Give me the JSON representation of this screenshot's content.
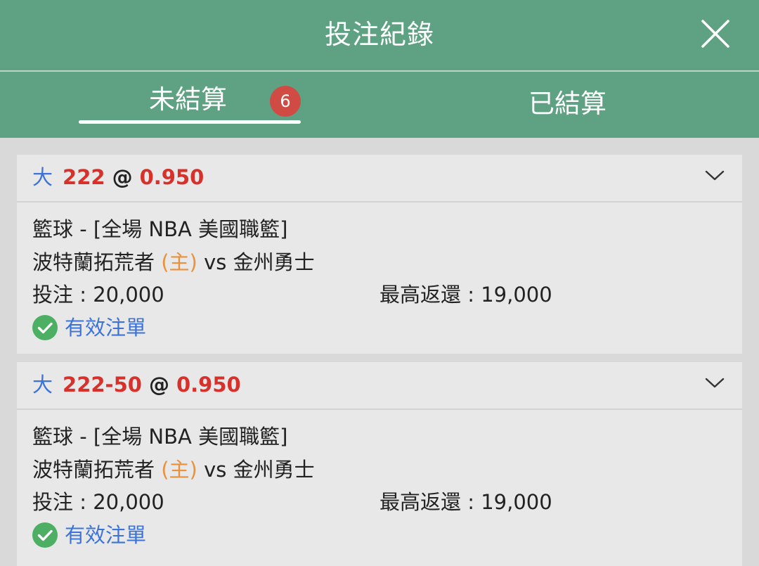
{
  "header": {
    "title": "投注紀錄"
  },
  "tabs": [
    {
      "label": "未結算",
      "badge": "6",
      "active": true
    },
    {
      "label": "已結算",
      "active": false
    }
  ],
  "colors": {
    "header_bg": "#5fa283",
    "badge_bg": "#d14b45",
    "selection_side": "#3b73d8",
    "odds_red": "#d7312b",
    "home_tag": "#e9913b",
    "status_green": "#4caf63",
    "status_text": "#3b73d8"
  },
  "bets": [
    {
      "side": "大",
      "line": "222",
      "at": "@",
      "odds": "0.950",
      "league": "籃球 - [全場 NBA 美國職籃]",
      "home_team": "波特蘭拓荒者",
      "home_tag": "(主)",
      "vs": "vs",
      "away_team": "金州勇士",
      "stake_label": "投注 :",
      "stake": "20,000",
      "return_label": "最高返還 :",
      "max_return": "19,000",
      "status": "有效注單",
      "status_icon": "check-circle-icon",
      "expand_icon": "chevron-down-icon"
    },
    {
      "side": "大",
      "line": "222-50",
      "at": "@",
      "odds": "0.950",
      "league": "籃球 - [全場 NBA 美國職籃]",
      "home_team": "波特蘭拓荒者",
      "home_tag": "(主)",
      "vs": "vs",
      "away_team": "金州勇士",
      "stake_label": "投注 :",
      "stake": "20,000",
      "return_label": "最高返還 :",
      "max_return": "19,000",
      "status": "有效注單",
      "status_icon": "check-circle-icon",
      "expand_icon": "chevron-down-icon"
    }
  ]
}
